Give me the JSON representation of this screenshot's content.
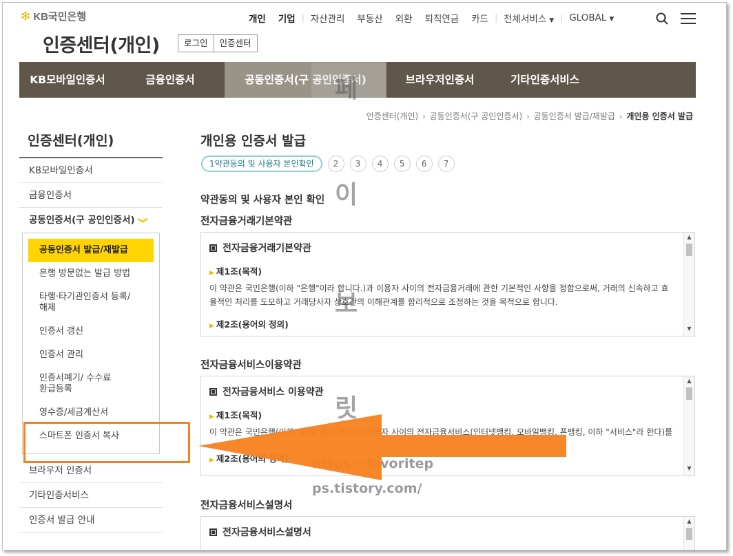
{
  "header": {
    "logo_text": "KB국민은행",
    "logo_star": "✻",
    "topnav": [
      {
        "label": "개인",
        "bold": true
      },
      {
        "label": "기업",
        "bold": true
      },
      {
        "label": "자산관리"
      },
      {
        "label": "부동산"
      },
      {
        "label": "외환"
      },
      {
        "label": "퇴직연금"
      },
      {
        "label": "카드"
      },
      {
        "label": "전체서비스"
      },
      {
        "label": "GLOBAL"
      }
    ],
    "caret": "▼",
    "site_title": "인증센터(개인)",
    "mini_tabs": [
      "로그인",
      "인증센터"
    ]
  },
  "gnb": [
    "KB모바일인증서",
    "금융인증서",
    "공동인증서(구 공인인증서)",
    "브라우저인증서",
    "기타인증서비스"
  ],
  "breadcrumb": [
    "인증센터(개인)",
    "공동인증서(구 공인인증서)",
    "공동인증서 발급/재발급",
    "개인용 인증서 발급"
  ],
  "sidebar": {
    "title": "인증센터(개인)",
    "items_before": [
      "KB모바일인증서",
      "금융인증서"
    ],
    "open_item": "공동인증서(구 공인인증서)",
    "chevron": "❯",
    "sub_items": [
      "공동인증서 발급/재발급",
      "은행 방문없는 발급 방법",
      "타행·타기관인증서 등록/해제",
      "인증서 갱신",
      "인증서 관리",
      "인증서폐기/ 수수료환급등록",
      "영수증/세금계산서",
      "스마트폰 인증서 복사"
    ],
    "items_after": [
      "브라우저 인증서",
      "기타인증서비스",
      "인증서 발급 안내"
    ]
  },
  "main": {
    "page_title": "개인용 인증서 발급",
    "step_active": "1약관동의 및 사용자 본인확인",
    "steps": [
      "2",
      "3",
      "4",
      "5",
      "6",
      "7"
    ],
    "section_heading": "약관동의 및 사용자 본인 확인",
    "terms": [
      {
        "title": "전자금융거래기본약관",
        "box_title": "전자금융거래기본약관",
        "art1": "제1조(목적)",
        "body1": "이 약관은 국민은행(이하 \"은행\"이라 합니다.)과 이용자 사이의 전자금융거래에 관한 기본적인 사항을 정함으로써, 거래의 신속하고 효율적인 처리를 도모하고 거래당사자 상호간의 이해관계를 합리적으로 조정하는 것을 목적으로 합니다.",
        "art2": "제2조(용어의 정의)"
      },
      {
        "title": "전자금융서비스이용약관",
        "box_title": "전자금융서비스 이용약관",
        "art1": "제1조(목적)",
        "body1": "이 약관은 국민은행(이하 \"은행\"이라 한다)과 이용자 사이의 전자금융서비스(인터넷뱅킹, 모바일뱅킹, 폰뱅킹, 이하 \"서비스\"라 한다)를 이용",
        "art2": "제2조(용어의 정의)"
      },
      {
        "title": "전자금융서비스설명서",
        "box_title": "전자금융서비스설명서"
      }
    ]
  },
  "watermark": {
    "chars": [
      "페",
      "이",
      "보",
      "릿"
    ],
    "url_line1": "https://favoritep",
    "url_line2": "ps.tistory.com/"
  },
  "colors": {
    "gnb_bg": "#5f5749",
    "gnb_active": "#9a9387",
    "accent_yellow": "#ffd400",
    "annotation_orange": "#f58220",
    "step_border": "#8fcfd3"
  }
}
